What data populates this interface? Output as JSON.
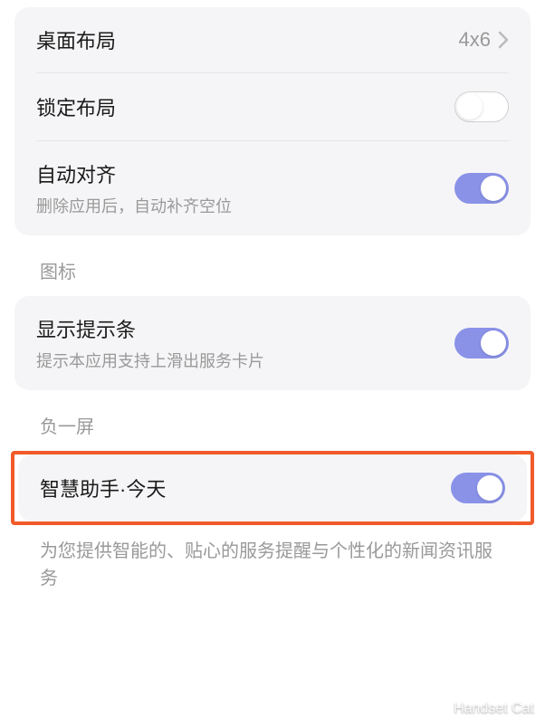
{
  "section1": {
    "desktop_layout": {
      "label": "桌面布局",
      "value": "4x6"
    },
    "lock_layout": {
      "label": "锁定布局",
      "enabled": false
    },
    "auto_align": {
      "label": "自动对齐",
      "subtitle": "删除应用后，自动补齐空位",
      "enabled": true
    }
  },
  "section2": {
    "header": "图标",
    "show_hint_bar": {
      "label": "显示提示条",
      "subtitle": "提示本应用支持上滑出服务卡片",
      "enabled": true
    }
  },
  "section3": {
    "header": "负一屏",
    "smart_assistant": {
      "label": "智慧助手·今天",
      "enabled": true
    },
    "description": "为您提供智能的、贴心的服务提醒与个性化的新闻资讯服务"
  },
  "watermark": "Handset Cat"
}
